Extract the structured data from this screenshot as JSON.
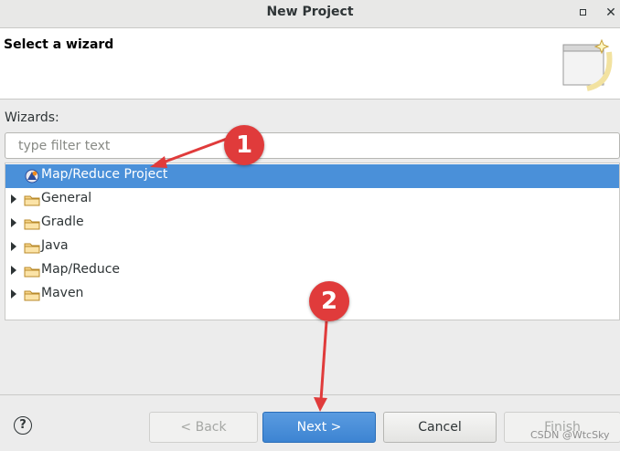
{
  "window": {
    "title": "New Project",
    "close_glyph": "✕"
  },
  "header": {
    "title": "Select a wizard",
    "banner_icon": "new-wizard-banner-icon"
  },
  "wizards": {
    "label": "Wizards:",
    "filter_placeholder": "type filter text",
    "items": [
      {
        "label": "Map/Reduce Project",
        "icon": "map-reduce-project-icon",
        "selected": true,
        "expandable": false
      },
      {
        "label": "General",
        "icon": "folder-icon",
        "selected": false,
        "expandable": true
      },
      {
        "label": "Gradle",
        "icon": "folder-icon",
        "selected": false,
        "expandable": true
      },
      {
        "label": "Java",
        "icon": "folder-icon",
        "selected": false,
        "expandable": true
      },
      {
        "label": "Map/Reduce",
        "icon": "folder-icon",
        "selected": false,
        "expandable": true
      },
      {
        "label": "Maven",
        "icon": "folder-icon",
        "selected": false,
        "expandable": true
      }
    ]
  },
  "footer": {
    "help": "?",
    "back": "< Back",
    "next": "Next >",
    "cancel": "Cancel",
    "finish": "Finish"
  },
  "annotations": {
    "badge_1": "1",
    "badge_2": "2"
  },
  "watermark": "CSDN @WtcSky",
  "colors": {
    "selection": "#4a90d9",
    "annotation": "#e03b3b",
    "primary_button": "#3d84d2"
  }
}
